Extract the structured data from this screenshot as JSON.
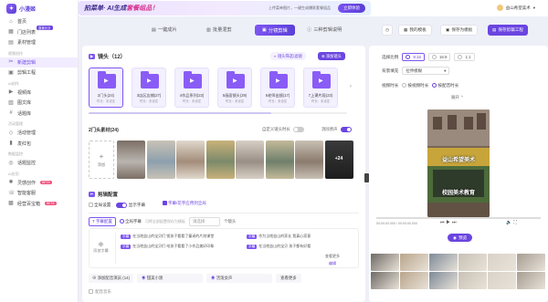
{
  "sidebar": {
    "brand": "小漫姬",
    "items": [
      {
        "label": "首页",
        "icon": "home-icon"
      },
      {
        "label": "门店列表",
        "icon": "store-icon",
        "badge": "直营元旦"
      },
      {
        "label": "素材管理",
        "icon": "folder-icon"
      },
      {
        "section": "视频创作"
      },
      {
        "label": "新建剪辑",
        "icon": "scissors-icon",
        "active": true
      },
      {
        "label": "剪辑工程",
        "icon": "project-icon"
      },
      {
        "section": "AI创作"
      },
      {
        "label": "视频库",
        "icon": "video-icon"
      },
      {
        "label": "图文库",
        "icon": "image-icon"
      },
      {
        "label": "话题库",
        "icon": "topic-icon"
      },
      {
        "section": "活动管理"
      },
      {
        "label": "活动管理",
        "icon": "activity-icon"
      },
      {
        "label": "发红包",
        "icon": "redpacket-icon"
      },
      {
        "section": "数据监控"
      },
      {
        "label": "话题监控",
        "icon": "monitor-icon"
      },
      {
        "section": "AI应用"
      },
      {
        "label": "灵感创作",
        "icon": "bulb-icon",
        "hot": "BETA"
      },
      {
        "label": "智能客服",
        "icon": "service-icon"
      },
      {
        "label": "经营百宝箱",
        "icon": "toolbox-icon",
        "hot": "BETA"
      }
    ]
  },
  "banner": {
    "title_a": "拍菜单",
    "title_b": "· AI生成",
    "title_c": "套餐组品！",
    "subtitle": "上传菜单图片，一键生成爆款套餐组品",
    "button": "立即体验"
  },
  "user": {
    "name": "益山希望美术"
  },
  "tabs": [
    {
      "label": "一键成片"
    },
    {
      "label": "批量混剪"
    },
    {
      "label": "分镜剪辑",
      "active": true
    },
    {
      "label": "三种剪辑说明"
    }
  ],
  "actions": {
    "history": "剪辑历史",
    "template": "我的模板",
    "save_template": "保存为模板",
    "save_project": "保存剪辑工程"
  },
  "shots": {
    "title": "镜头（12）",
    "filter_btn": "镜头筛选/滤镜",
    "add_btn": "添加镜头",
    "items": [
      {
        "label": "2门头(24)",
        "meta": "时长：未设定"
      },
      {
        "label": "3店区店铺(27)",
        "meta": "时长：未设定"
      },
      {
        "label": "4作品系列(23)",
        "meta": "时长：未设定"
      },
      {
        "label": "5画面镜头(29)",
        "meta": "时长：未设定"
      },
      {
        "label": "6老师出镜(17)",
        "meta": "时长：未设定"
      },
      {
        "label": "7上课片段(23)",
        "meta": "时长：未设定"
      }
    ]
  },
  "materials": {
    "title": "2门头素材(24)",
    "custom_duration": "自定义镜头时长",
    "remove_audio": "消除原声",
    "add": "添加",
    "more": "+24"
  },
  "config": {
    "title": "剪辑配置",
    "global_settings": "全局设置",
    "show_subtitle": "显示字幕",
    "subtitle_opt": "字幕/花字应用到全局",
    "subtitle_cfg": "字幕配置",
    "global_voice": "全局字幕",
    "hint": "可将全部配置保存为模板",
    "select_placeholder": "请选择",
    "count": "个镜头",
    "add_subtitle": "添加字幕",
    "line1": "在当地益山的宝贝们 锁孩子看看了童谣的片刻课堂",
    "line2": "在当地益山的宝贝们 给孩子看看了小作品美好印象",
    "line3": "作为当地益山的家长 我真心家意",
    "line4": "在当地益山的宝贝 孩子都有好看",
    "more_btn": "查看更多",
    "edit_btn": "编辑",
    "add_voice": "添加配音演员",
    "voice1": "甜美小渡",
    "voice2": "活泼女声",
    "bgm": "配音音乐",
    "voice_count": "(14)",
    "tag": "字幕"
  },
  "right": {
    "ratio_label": "选择比例",
    "ratios": [
      "9:16",
      "16:9",
      "1:1"
    ],
    "bg_label": "背景填充",
    "bg_value": "拉伸模糊",
    "duration_label": "视频时长",
    "dur_opt1": "按视频时长",
    "dur_opt2": "按配音时长",
    "expand": "展开",
    "time": "00:00:00.000 / 00:00:00.000",
    "preview": "预览",
    "video_caption_top": "益山希望美术",
    "video_caption_bottom": "校园美术教育"
  },
  "colors": {
    "accent": "#6a45e0",
    "hot": "#f04f7a"
  }
}
